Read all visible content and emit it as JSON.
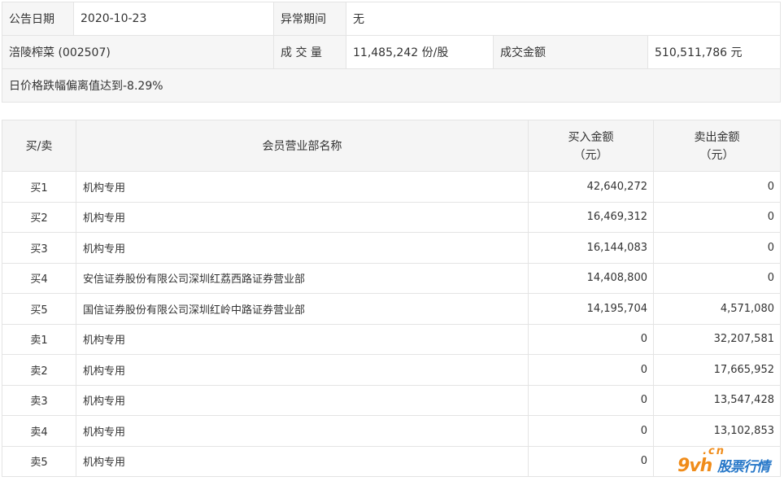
{
  "info": {
    "date_label": "公告日期",
    "date_value": "2020-10-23",
    "period_label": "异常期间",
    "period_value": "无",
    "stock": "涪陵榨菜 (002507)",
    "volume_label": "成 交 量",
    "volume_value": "11,485,242 份/股",
    "amount_label": "成交金额",
    "amount_value": "510,511,786 元",
    "reason": "日价格跌幅偏离值达到-8.29%"
  },
  "table": {
    "headers": {
      "side": "买/卖",
      "name": "会员营业部名称",
      "buy": "买入金额",
      "buy_unit": "（元）",
      "sell": "卖出金额",
      "sell_unit": "（元）"
    },
    "rows": [
      {
        "side": "买1",
        "name": "机构专用",
        "buy": "42,640,272",
        "sell": "0"
      },
      {
        "side": "买2",
        "name": "机构专用",
        "buy": "16,469,312",
        "sell": "0"
      },
      {
        "side": "买3",
        "name": "机构专用",
        "buy": "16,144,083",
        "sell": "0"
      },
      {
        "side": "买4",
        "name": "安信证券股份有限公司深圳红荔西路证券营业部",
        "buy": "14,408,800",
        "sell": "0"
      },
      {
        "side": "买5",
        "name": "国信证券股份有限公司深圳红岭中路证券营业部",
        "buy": "14,195,704",
        "sell": "4,571,080"
      },
      {
        "side": "卖1",
        "name": "机构专用",
        "buy": "0",
        "sell": "32,207,581"
      },
      {
        "side": "卖2",
        "name": "机构专用",
        "buy": "0",
        "sell": "17,665,952"
      },
      {
        "side": "卖3",
        "name": "机构专用",
        "buy": "0",
        "sell": "13,547,428"
      },
      {
        "side": "卖4",
        "name": "机构专用",
        "buy": "0",
        "sell": "13,102,853"
      },
      {
        "side": "卖5",
        "name": "机构专用",
        "buy": "0",
        "sell": ""
      }
    ]
  },
  "watermark": {
    "cn": ".cn",
    "brand": "9vh",
    "text": "股票行情"
  }
}
